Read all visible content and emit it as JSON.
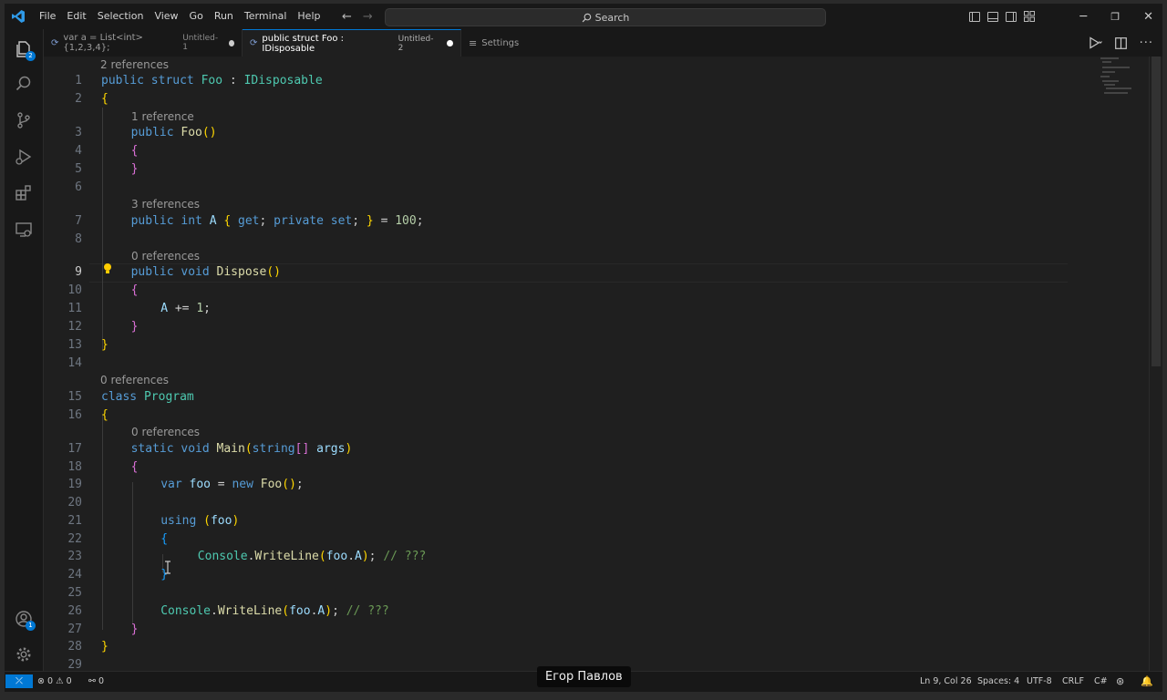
{
  "window": {
    "menu": [
      "File",
      "Edit",
      "Selection",
      "View",
      "Go",
      "Run",
      "Terminal",
      "Help"
    ],
    "search_label": "Search"
  },
  "activity_bar": {
    "items": [
      {
        "name": "explorer-icon",
        "badge": "2"
      },
      {
        "name": "search-icon"
      },
      {
        "name": "source-control-icon"
      },
      {
        "name": "run-debug-icon"
      },
      {
        "name": "extensions-icon"
      },
      {
        "name": "remote-explorer-icon"
      }
    ],
    "accounts_badge": "1"
  },
  "tabs": [
    {
      "label": "var a = List<int> {1,2,3,4};",
      "description": "Untitled-1",
      "dirty": true,
      "active": false
    },
    {
      "label": "public struct Foo : IDisposable",
      "description": "Untitled-2",
      "dirty": true,
      "active": true
    },
    {
      "label": "Settings",
      "description": "",
      "dirty": false,
      "active": false
    }
  ],
  "editor": {
    "codelens": [
      "2 references",
      "1 reference",
      "3 references",
      "0 references",
      "0 references",
      "0 references"
    ],
    "line_numbers": [
      "1",
      "2",
      "3",
      "4",
      "5",
      "6",
      "7",
      "8",
      "9",
      "10",
      "11",
      "12",
      "13",
      "14",
      "15",
      "16",
      "17",
      "18",
      "19",
      "20",
      "21",
      "22",
      "23",
      "24",
      "25",
      "26",
      "27",
      "28",
      "29"
    ],
    "active_line": "9",
    "lines": [
      "public struct Foo : IDisposable",
      "{",
      "public Foo()",
      "{",
      "}",
      "",
      "public int A { get; private set; } = 100;",
      "",
      "public void Dispose()",
      "{",
      "A += 1;",
      "}",
      "}",
      "",
      "class Program",
      "{",
      "static void Main(string[] args)",
      "{",
      "var foo = new Foo();",
      "",
      "using (foo)",
      "{",
      "Console.WriteLine(foo.A); // ???",
      "}",
      "",
      "Console.WriteLine(foo.A); // ???",
      "}",
      "}",
      ""
    ]
  },
  "status_bar": {
    "errors": "0",
    "warnings": "0",
    "ports": "0",
    "position": "Ln 9, Col 26",
    "indent": "Spaces: 4",
    "encoding": "UTF-8",
    "eol": "CRLF",
    "language": "C#"
  },
  "caption": "Егор Павлов",
  "colors": {
    "accent": "#0078d4",
    "editor_bg": "#1f1f1f",
    "keyword": "#569cd6",
    "type": "#4ec9b0",
    "function": "#dcdcaa",
    "variable": "#9cdcfe",
    "number": "#b5cea8",
    "comment": "#6a9955"
  }
}
